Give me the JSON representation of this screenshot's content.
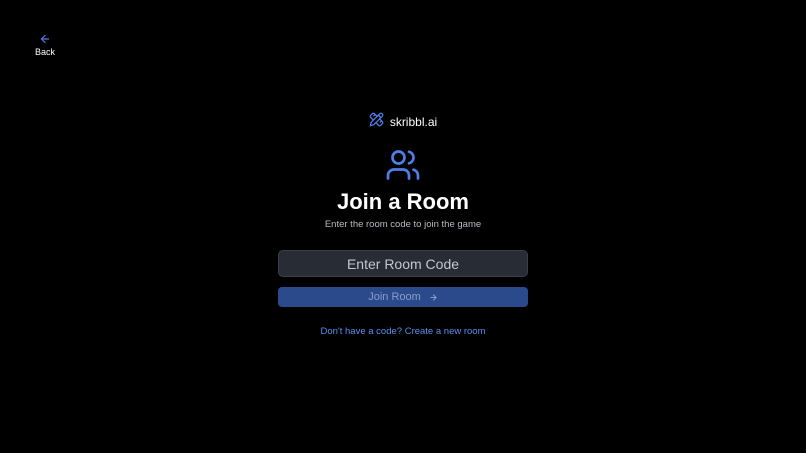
{
  "nav": {
    "back_label": "Back"
  },
  "brand": {
    "name": "skribbl.ai"
  },
  "main": {
    "title": "Join a Room",
    "subtitle": "Enter the room code to join the game",
    "code_placeholder": "Enter Room Code",
    "code_value": "",
    "join_label": "Join Room",
    "create_link": "Don't have a code? Create a new room"
  },
  "icons": {
    "back": "arrow-left-icon",
    "logo": "pencil-ruler-icon",
    "users": "users-icon",
    "join": "arrow-right-icon"
  },
  "colors": {
    "background": "#000000",
    "accent": "#4f7ee8",
    "button_bg": "#2a4a8c",
    "input_bg": "#282c34",
    "link": "#5b8ef0"
  }
}
